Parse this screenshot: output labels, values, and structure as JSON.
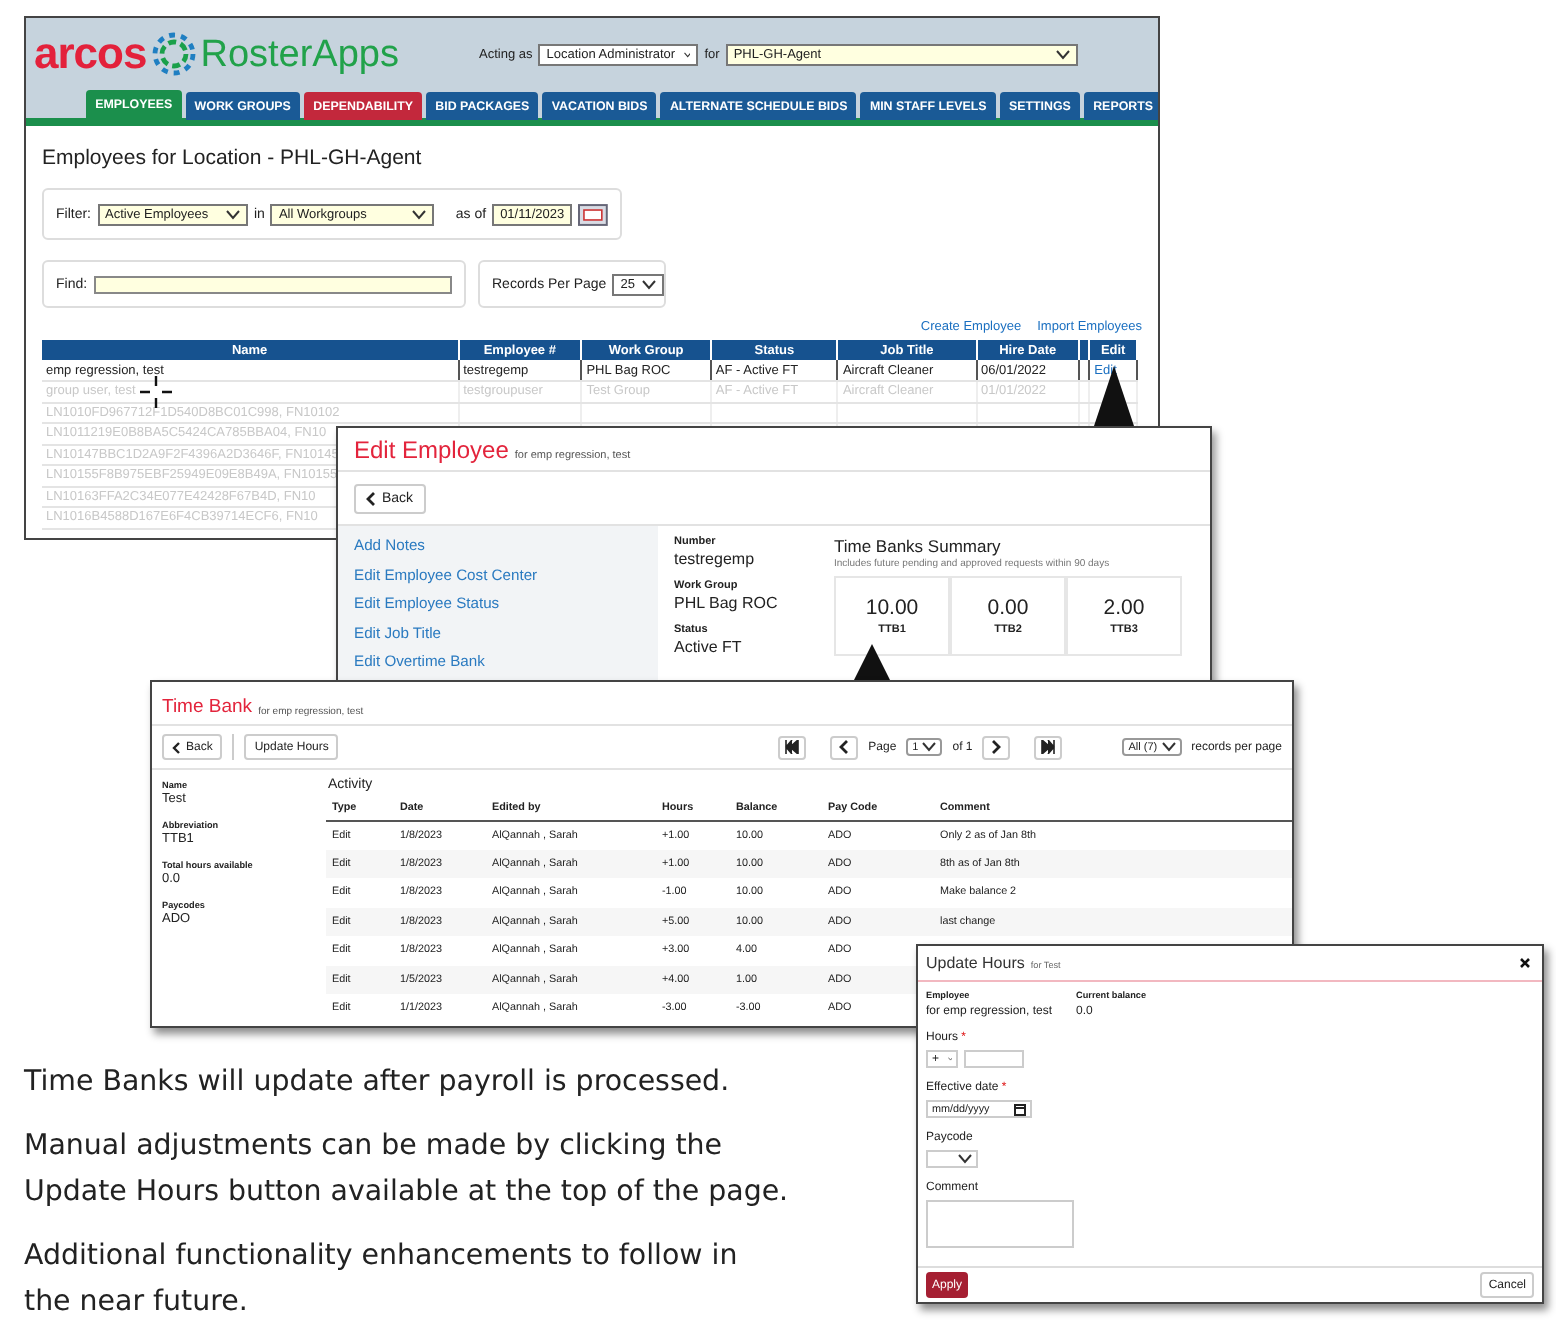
{
  "main": {
    "logo": "arcos",
    "app_name": "RosterApps",
    "acting_as_label": "Acting as",
    "acting_as": "Location Administrator",
    "for_label": "for",
    "location": "PHL-GH-Agent",
    "tabs": [
      {
        "label": "EMPLOYEES",
        "selected": true,
        "color": "#1b8f4c"
      },
      {
        "label": "WORK GROUPS",
        "selected": false,
        "color": "#1a5a96"
      },
      {
        "label": "DEPENDABILITY",
        "selected": false,
        "color": "#c3283c"
      },
      {
        "label": "BID PACKAGES",
        "selected": false,
        "color": "#1a5a96"
      },
      {
        "label": "VACATION BIDS",
        "selected": false,
        "color": "#1a5a96"
      },
      {
        "label": "ALTERNATE SCHEDULE BIDS",
        "selected": false,
        "color": "#1a5a96"
      },
      {
        "label": "MIN STAFF LEVELS",
        "selected": false,
        "color": "#1a5a96"
      },
      {
        "label": "SETTINGS",
        "selected": false,
        "color": "#1a5a96"
      },
      {
        "label": "REPORTS",
        "selected": false,
        "color": "#1a5a96"
      }
    ],
    "heading": "Employees for Location - PHL-GH-Agent",
    "filter": {
      "label": "Filter:",
      "status": "Active Employees",
      "in_label": "in",
      "workgroup": "All Workgroups",
      "as_of_label": "as of",
      "date": "01/11/2023"
    },
    "find": {
      "label": "Find:"
    },
    "records_per_page": {
      "label": "Records Per Page",
      "value": "25"
    },
    "links": [
      "Create Employee",
      "Import Employees"
    ],
    "table": {
      "columns": [
        "Name",
        "Employee #",
        "Work Group",
        "Status",
        "Job Title",
        "Hire Date",
        "Edit"
      ],
      "rows": [
        {
          "cells": [
            "emp regression, test",
            "testregemp",
            "PHL Bag ROC",
            "AF - Active FT",
            "Aircraft Cleaner",
            "06/01/2022"
          ],
          "edit": "Edit",
          "dimmed": false
        },
        {
          "cells": [
            "group user, test",
            "testgroupuser",
            "Test Group",
            "AF - Active FT",
            "Aircraft Cleaner",
            "01/01/2022"
          ],
          "dimmed": true
        },
        {
          "cells": [
            "LN1010FD967712F1D540D8BC01C998, FN10102"
          ],
          "dimmed": true
        },
        {
          "cells": [
            "LN1011219E0B8BA5C5424CA785BBA04, FN10"
          ],
          "dimmed": true
        },
        {
          "cells": [
            "LN10147BBC1D2A9F2F4396A2D3646F, FN10145"
          ],
          "dimmed": true
        },
        {
          "cells": [
            "LN10155F8B975EBF25949E09E8B49A, FN10155"
          ],
          "dimmed": true
        },
        {
          "cells": [
            "LN10163FFA2C34E077E42428F67B4D, FN10"
          ],
          "dimmed": true
        },
        {
          "cells": [
            "LN1016B4588D167E6F4CB39714ECF6, FN10"
          ],
          "dimmed": true
        }
      ]
    }
  },
  "edit_employee": {
    "title": "Edit Employee",
    "subtitle": "for emp regression, test",
    "back": "Back",
    "menu": [
      "Add Notes",
      "Edit Employee Cost Center",
      "Edit Employee Status",
      "Edit Job Title",
      "Edit Overtime Bank"
    ],
    "details": [
      {
        "label": "Number",
        "value": "testregemp"
      },
      {
        "label": "Work Group",
        "value": "PHL Bag ROC"
      },
      {
        "label": "Status",
        "value": "Active FT"
      }
    ],
    "summary_title": "Time Banks Summary",
    "summary_note": "Includes future pending and approved requests within 90 days",
    "tiles": [
      {
        "value": "10.00",
        "label": "TTB1"
      },
      {
        "value": "0.00",
        "label": "TTB2"
      },
      {
        "value": "2.00",
        "label": "TTB3"
      }
    ]
  },
  "time_bank": {
    "title": "Time Bank",
    "subtitle": "for emp regression, test",
    "back": "Back",
    "update_button": "Update Hours",
    "pager": {
      "page_label": "Page",
      "page": "1",
      "of": "of 1",
      "per_page": "All (7)",
      "per_page_label": "records per page"
    },
    "details": [
      {
        "label": "Name",
        "value": "Test"
      },
      {
        "label": "Abbreviation",
        "value": "TTB1"
      },
      {
        "label": "Total hours available",
        "value": "0.0"
      },
      {
        "label": "Paycodes",
        "value": "ADO"
      }
    ],
    "activity_title": "Activity",
    "columns": [
      "Type",
      "Date",
      "Edited by",
      "Hours",
      "Balance",
      "Pay Code",
      "Comment"
    ],
    "rows": [
      [
        "Edit",
        "1/8/2023",
        "AlQannah , Sarah",
        "+1.00",
        "10.00",
        "ADO",
        "Only 2 as of Jan 8th"
      ],
      [
        "Edit",
        "1/8/2023",
        "AlQannah , Sarah",
        "+1.00",
        "10.00",
        "ADO",
        "8th as of Jan 8th"
      ],
      [
        "Edit",
        "1/8/2023",
        "AlQannah , Sarah",
        "-1.00",
        "10.00",
        "ADO",
        "Make balance 2"
      ],
      [
        "Edit",
        "1/8/2023",
        "AlQannah , Sarah",
        "+5.00",
        "10.00",
        "ADO",
        "last change"
      ],
      [
        "Edit",
        "1/8/2023",
        "AlQannah , Sarah",
        "+3.00",
        "4.00",
        "ADO"
      ],
      [
        "Edit",
        "1/5/2023",
        "AlQannah , Sarah",
        "+4.00",
        "1.00",
        "ADO"
      ],
      [
        "Edit",
        "1/1/2023",
        "AlQannah , Sarah",
        "-3.00",
        "-3.00",
        "ADO"
      ]
    ]
  },
  "update_hours": {
    "title": "Update Hours",
    "subtitle": "for Test",
    "info": [
      {
        "label": "Employee",
        "value": "for emp regression, test"
      },
      {
        "label": "Current balance",
        "value": "0.0"
      }
    ],
    "fields": [
      {
        "kind": "hours",
        "label": "Hours",
        "required_mark": "*",
        "sign": "+"
      },
      {
        "kind": "date",
        "label": "Effective date",
        "required_mark": "*",
        "placeholder": "mm/dd/yyyy"
      },
      {
        "kind": "select",
        "label": "Paycode"
      },
      {
        "kind": "textarea",
        "label": "Comment"
      }
    ],
    "apply": "Apply",
    "cancel": "Cancel"
  },
  "notes": [
    "Time Banks will update after payroll is processed.",
    "Manual adjustments can be made by clicking the Update Hours button available at the top of the page.",
    "Additional functionality enhancements to follow in the near future."
  ]
}
